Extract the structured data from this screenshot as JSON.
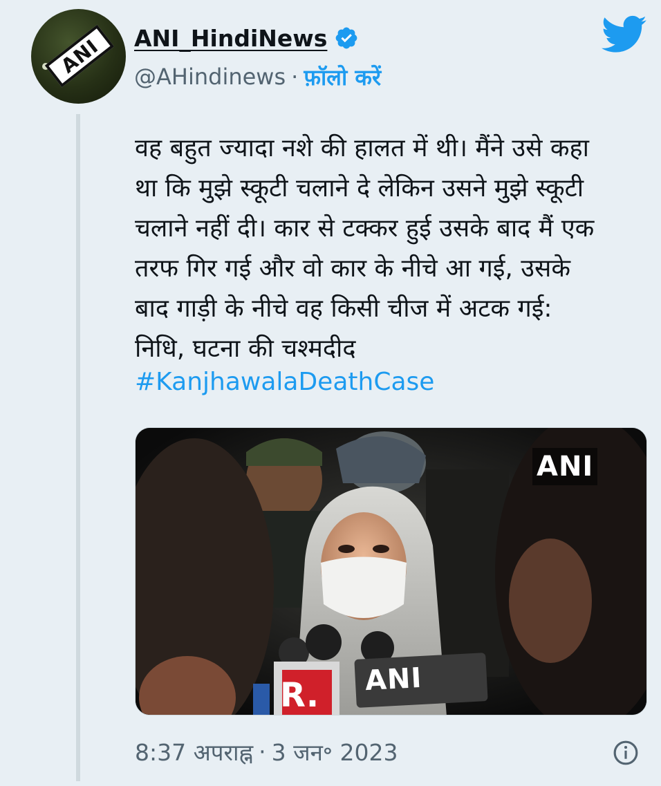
{
  "tweet": {
    "author": {
      "display_name": "ANI_HindiNews",
      "handle": "@AHindinews",
      "follow_label": "फ़ॉलो करें",
      "separator": "·",
      "avatar_text": "ANI",
      "verified": true
    },
    "platform_icon": "twitter-bird-icon",
    "text": "वह बहुत ज्यादा नशे की हालत में थी। मैंने उसे कहा\nथा कि मुझे स्कूटी चलाने दे लेकिन उसने मुझे स्कूटी\nचलाने नहीं दी। कार से टक्कर हुई उसके बाद मैं एक\nतरफ गिर गई और वो कार के नीचे आ गई, उसके\nबाद गाड़ी के नीचे वह किसी चीज में अटक गई:\nनिधि, घटना की चश्मदीद",
    "hashtag": "#KanjhawalaDeathCase",
    "media": {
      "watermark": "ANI",
      "mic_label_r": "R.",
      "mic_label_ani": "ANI"
    },
    "footer": {
      "time": "8:37 अपराह्न",
      "separator": "·",
      "date": "3 जन॰ 2023",
      "info_icon": "info-icon"
    }
  },
  "colors": {
    "background": "#e8eff4",
    "link_blue": "#1d9bf0",
    "secondary_text": "#536471",
    "primary_text": "#0f1419"
  }
}
